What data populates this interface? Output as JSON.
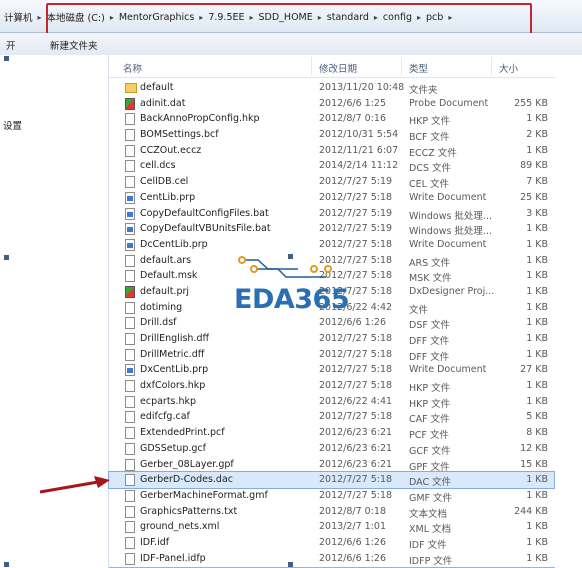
{
  "address": {
    "crumbs": [
      "计算机",
      "本地磁盘 (C:)",
      "MentorGraphics",
      "7.9.5EE",
      "SDD_HOME",
      "standard",
      "config",
      "pcb"
    ]
  },
  "toolbar": {
    "open_label": "开",
    "new_folder_label": "新建文件夹"
  },
  "nav": {
    "item_label": "设置"
  },
  "columns": {
    "name": "名称",
    "date": "修改日期",
    "type": "类型",
    "size": "大小"
  },
  "watermark": "EDA365",
  "files": [
    {
      "name": "default",
      "date": "2013/11/20 10:48",
      "type": "文件夹",
      "size": "",
      "icon": "folder"
    },
    {
      "name": "adinit.dat",
      "date": "2012/6/6 1:25",
      "type": "Probe Document",
      "size": "255 KB",
      "icon": "exe"
    },
    {
      "name": "BackAnnoPropConfig.hkp",
      "date": "2012/8/7 0:16",
      "type": "HKP 文件",
      "size": "1 KB",
      "icon": "file"
    },
    {
      "name": "BOMSettings.bcf",
      "date": "2012/10/31 5:54",
      "type": "BCF 文件",
      "size": "2 KB",
      "icon": "file"
    },
    {
      "name": "CCZOut.eccz",
      "date": "2012/11/21 6:07",
      "type": "ECCZ 文件",
      "size": "1 KB",
      "icon": "file"
    },
    {
      "name": "cell.dcs",
      "date": "2014/2/14 11:12",
      "type": "DCS 文件",
      "size": "89 KB",
      "icon": "file"
    },
    {
      "name": "CellDB.cel",
      "date": "2012/7/27 5:19",
      "type": "CEL 文件",
      "size": "7 KB",
      "icon": "file"
    },
    {
      "name": "CentLib.prp",
      "date": "2012/7/27 5:18",
      "type": "Write Document",
      "size": "25 KB",
      "icon": "doc"
    },
    {
      "name": "CopyDefaultConfigFiles.bat",
      "date": "2012/7/27 5:19",
      "type": "Windows 批处理...",
      "size": "3 KB",
      "icon": "doc"
    },
    {
      "name": "CopyDefaultVBUnitsFile.bat",
      "date": "2012/7/27 5:19",
      "type": "Windows 批处理...",
      "size": "1 KB",
      "icon": "doc"
    },
    {
      "name": "DcCentLib.prp",
      "date": "2012/7/27 5:18",
      "type": "Write Document",
      "size": "1 KB",
      "icon": "doc"
    },
    {
      "name": "default.ars",
      "date": "2012/7/27 5:18",
      "type": "ARS 文件",
      "size": "1 KB",
      "icon": "file"
    },
    {
      "name": "Default.msk",
      "date": "2012/7/27 5:18",
      "type": "MSK 文件",
      "size": "1 KB",
      "icon": "file"
    },
    {
      "name": "default.prj",
      "date": "2012/7/27 5:18",
      "type": "DxDesigner Proj...",
      "size": "1 KB",
      "icon": "exe"
    },
    {
      "name": "dotiming",
      "date": "2012/6/22 4:42",
      "type": "文件",
      "size": "1 KB",
      "icon": "file"
    },
    {
      "name": "Drill.dsf",
      "date": "2012/6/6 1:26",
      "type": "DSF 文件",
      "size": "1 KB",
      "icon": "file"
    },
    {
      "name": "DrillEnglish.dff",
      "date": "2012/7/27 5:18",
      "type": "DFF 文件",
      "size": "1 KB",
      "icon": "file"
    },
    {
      "name": "DrillMetric.dff",
      "date": "2012/7/27 5:18",
      "type": "DFF 文件",
      "size": "1 KB",
      "icon": "file"
    },
    {
      "name": "DxCentLib.prp",
      "date": "2012/7/27 5:18",
      "type": "Write Document",
      "size": "27 KB",
      "icon": "doc"
    },
    {
      "name": "dxfColors.hkp",
      "date": "2012/7/27 5:18",
      "type": "HKP 文件",
      "size": "1 KB",
      "icon": "file"
    },
    {
      "name": "ecparts.hkp",
      "date": "2012/6/22 4:41",
      "type": "HKP 文件",
      "size": "1 KB",
      "icon": "file"
    },
    {
      "name": "edifcfg.caf",
      "date": "2012/7/27 5:18",
      "type": "CAF 文件",
      "size": "5 KB",
      "icon": "file"
    },
    {
      "name": "ExtendedPrint.pcf",
      "date": "2012/6/23 6:21",
      "type": "PCF 文件",
      "size": "8 KB",
      "icon": "file"
    },
    {
      "name": "GDSSetup.gcf",
      "date": "2012/6/23 6:21",
      "type": "GCF 文件",
      "size": "12 KB",
      "icon": "file"
    },
    {
      "name": "Gerber_08Layer.gpf",
      "date": "2012/6/23 6:21",
      "type": "GPF 文件",
      "size": "15 KB",
      "icon": "file"
    },
    {
      "name": "GerberD-Codes.dac",
      "date": "2012/7/27 5:18",
      "type": "DAC 文件",
      "size": "1 KB",
      "icon": "file",
      "selected": true
    },
    {
      "name": "GerberMachineFormat.gmf",
      "date": "2012/7/27 5:18",
      "type": "GMF 文件",
      "size": "1 KB",
      "icon": "file"
    },
    {
      "name": "GraphicsPatterns.txt",
      "date": "2012/8/7 0:18",
      "type": "文本文档",
      "size": "244 KB",
      "icon": "file"
    },
    {
      "name": "ground_nets.xml",
      "date": "2013/2/7 1:01",
      "type": "XML 文档",
      "size": "1 KB",
      "icon": "file"
    },
    {
      "name": "IDF.idf",
      "date": "2012/6/6 1:26",
      "type": "IDF 文件",
      "size": "1 KB",
      "icon": "file"
    },
    {
      "name": "IDF-Panel.idfp",
      "date": "2012/6/6 1:26",
      "type": "IDFP 文件",
      "size": "1 KB",
      "icon": "file"
    }
  ]
}
